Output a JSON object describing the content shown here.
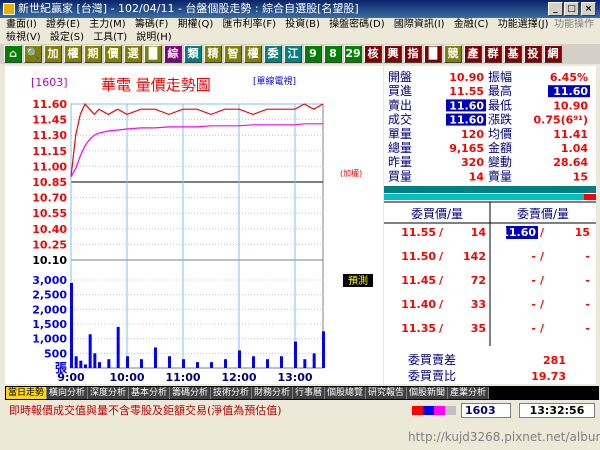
{
  "title": "新世紀贏家 [台灣] - 102/04/11 - 台盤個股走勢 : 綜合自選股[名望股]",
  "window_buttons": [
    "_",
    "□",
    "×"
  ],
  "menu_row1": [
    "畫面(I)",
    "證券(E)",
    "主力(M)",
    "籌碼(F)",
    "期權(Q)",
    "匯市利率(F)",
    "投資(B)",
    "操盤密碼(D)",
    "國際資訊(I)",
    "金融(C)",
    "功能選擇(J)"
  ],
  "menu_row1_dim": "功能操作",
  "menu_row2": [
    "檢視(V)",
    "設定(S)",
    "工具(T)",
    "說明(H)"
  ],
  "toolbar": [
    {
      "label": "⌂",
      "color": "#008000"
    },
    {
      "label": "🔍",
      "color": "#808000"
    },
    {
      "label": "加",
      "color": "#808000"
    },
    {
      "label": "權",
      "color": "#808000"
    },
    {
      "label": "期",
      "color": "#808000"
    },
    {
      "label": "價",
      "color": "#808000"
    },
    {
      "label": "選",
      "color": "#808000"
    },
    {
      "label": "█",
      "color": "#808000"
    },
    {
      "label": "綜",
      "color": "#800080"
    },
    {
      "label": "類",
      "color": "#008080"
    },
    {
      "label": "精",
      "color": "#808000"
    },
    {
      "label": "智",
      "color": "#808000"
    },
    {
      "label": "權",
      "color": "#808000"
    },
    {
      "label": "委",
      "color": "#008080"
    },
    {
      "label": "江",
      "color": "#008080"
    },
    {
      "label": "9",
      "color": "#008000"
    },
    {
      "label": "8",
      "color": "#008000"
    },
    {
      "label": "29",
      "color": "#008000"
    },
    {
      "label": "核",
      "color": "#800000"
    },
    {
      "label": "興",
      "color": "#800000"
    },
    {
      "label": "指",
      "color": "#800000"
    },
    {
      "label": "█",
      "color": "#800000"
    },
    {
      "label": "競",
      "color": "#808000"
    },
    {
      "label": "產",
      "color": "#800000"
    },
    {
      "label": "群",
      "color": "#800000"
    },
    {
      "label": "基",
      "color": "#800000"
    },
    {
      "label": "投",
      "color": "#800000"
    },
    {
      "label": "網",
      "color": "#800000"
    }
  ],
  "chart": {
    "code": "[1603]",
    "title": "華電  量價走勢圖",
    "mode_label": "[單線電視]",
    "unit_label": "(加權)",
    "price_ticks": [
      "11.60",
      "11.45",
      "11.30",
      "11.15",
      "11.00",
      "10.85",
      "10.70",
      "10.55",
      "10.40",
      "10.25",
      "10.10"
    ],
    "volume_ticks": [
      "3,000",
      "2,500",
      "2,000",
      "1,500",
      "1,000",
      "500"
    ],
    "volume_unit": "張",
    "forecast_label": "預測",
    "time_ticks": [
      "9:00",
      "10:00",
      "11:00",
      "12:00",
      "13:00"
    ]
  },
  "chart_data": {
    "type": "line",
    "title": "華電  量價走勢圖",
    "x": [
      "9:00",
      "9:05",
      "9:10",
      "9:15",
      "9:20",
      "9:25",
      "9:30",
      "9:40",
      "9:50",
      "10:00",
      "10:15",
      "10:30",
      "10:45",
      "11:00",
      "11:15",
      "11:30",
      "11:45",
      "12:00",
      "12:15",
      "12:30",
      "12:45",
      "13:00",
      "13:10",
      "13:20",
      "13:30"
    ],
    "series": [
      {
        "name": "成交價",
        "values": [
          10.9,
          11.3,
          11.5,
          11.6,
          11.55,
          11.5,
          11.55,
          11.5,
          11.55,
          11.5,
          11.55,
          11.55,
          11.5,
          11.55,
          11.55,
          11.5,
          11.55,
          11.55,
          11.5,
          11.55,
          11.55,
          11.55,
          11.6,
          11.55,
          11.6
        ]
      },
      {
        "name": "均價",
        "values": [
          10.9,
          10.98,
          11.1,
          11.2,
          11.26,
          11.3,
          11.32,
          11.34,
          11.35,
          11.36,
          11.37,
          11.37,
          11.38,
          11.38,
          11.38,
          11.39,
          11.39,
          11.39,
          11.4,
          11.4,
          11.4,
          11.4,
          11.41,
          11.41,
          11.41
        ]
      }
    ],
    "volumes": [
      2900,
      400,
      250,
      120,
      1150,
      500,
      200,
      300,
      1400,
      400,
      300,
      700,
      400,
      300,
      200,
      200,
      300,
      600,
      400,
      300,
      400,
      900,
      300,
      500,
      1250
    ],
    "ylim": [
      10.1,
      11.6
    ],
    "vlim": [
      0,
      3000
    ],
    "reference_line": 10.85
  },
  "quote": {
    "left": [
      {
        "label": "開盤",
        "value": "10.90",
        "color": "#ff0000"
      },
      {
        "label": "買進",
        "value": "11.55",
        "color": "#ff0000"
      },
      {
        "label": "賣出",
        "value": "11.60",
        "color": "#ffffff",
        "highlight": true
      },
      {
        "label": "成交",
        "value": "11.60",
        "color": "#ffffff",
        "highlight": true
      },
      {
        "label": "單量",
        "value": "120",
        "color": "#ff0000"
      },
      {
        "label": "總量",
        "value": "9,165",
        "color": "#ff0000"
      },
      {
        "label": "昨量",
        "value": "320",
        "color": "#ff0000"
      },
      {
        "label": "買量",
        "value": "14",
        "color": "#ff0000"
      }
    ],
    "right": [
      {
        "label": "振幅",
        "value": "6.45%",
        "color": "#ff0000"
      },
      {
        "label": "最高",
        "value": "11.60",
        "color": "#ffffff",
        "highlight": true
      },
      {
        "label": "最低",
        "value": "10.90",
        "color": "#ff0000"
      },
      {
        "label": "漲跌",
        "value": "0.75(6⁹¹)",
        "color": "#ff0000"
      },
      {
        "label": "均價",
        "value": "11.41",
        "color": "#ff0000"
      },
      {
        "label": "金額",
        "value": "1.04",
        "color": "#ff0000"
      },
      {
        "label": "變動",
        "value": "28.64",
        "color": "#ff0000"
      },
      {
        "label": "賣量",
        "value": "15",
        "color": "#ff0000"
      }
    ],
    "bid_header": "委買價/量",
    "ask_header": "委賣價/量",
    "bids": [
      {
        "price": "11.55",
        "qty": "14"
      },
      {
        "price": "11.50",
        "qty": "142"
      },
      {
        "price": "11.45",
        "qty": "72"
      },
      {
        "price": "11.40",
        "qty": "33"
      },
      {
        "price": "11.35",
        "qty": "35"
      }
    ],
    "asks": [
      {
        "price": "11.60",
        "qty": "15",
        "highlight": true
      },
      {
        "price": "-",
        "qty": "-"
      },
      {
        "price": "-",
        "qty": "-"
      },
      {
        "price": "-",
        "qty": "-"
      },
      {
        "price": "-",
        "qty": "-"
      }
    ],
    "bid_diff_label": "委買賣差",
    "bid_diff_value": "281",
    "bid_ratio_label": "委買賣比",
    "bid_ratio_value": "19.73"
  },
  "tabs": [
    "當日走勢",
    "橫向分析",
    "深度分析",
    "基本分析",
    "籌碼分析",
    "技術分析",
    "財務分析",
    "行事曆",
    "個股總覽",
    "研究報告",
    "個股新聞",
    "產業分析"
  ],
  "status": {
    "message": "即時報價成交值與量不含零股及鉅額交易(淨值為預估值)",
    "code": "1603",
    "time": "13:32:56"
  },
  "watermark": "http://kujd3268.pixnet.net/album"
}
